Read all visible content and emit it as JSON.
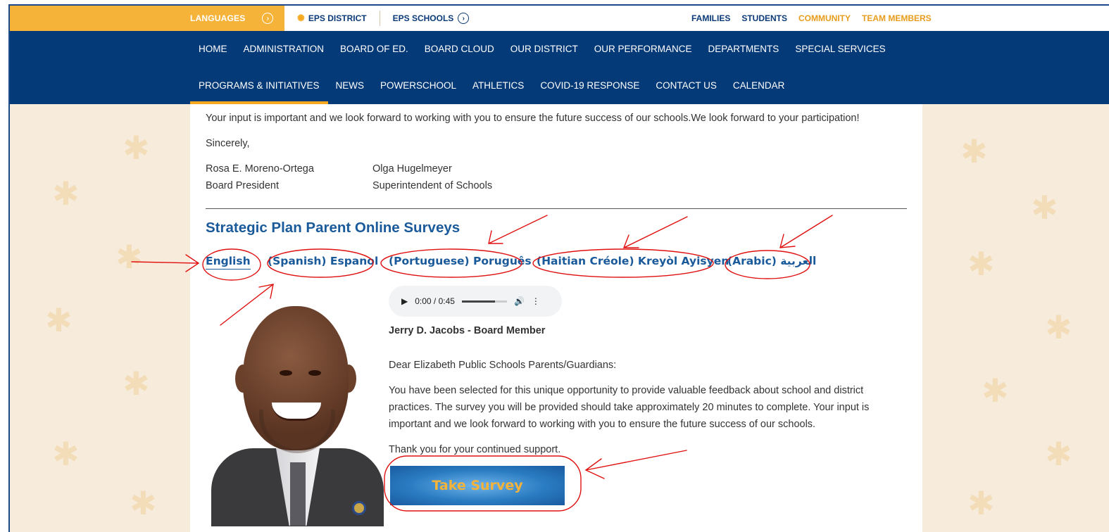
{
  "topbar": {
    "languages_label": "LANGUAGES",
    "eps_district": "EPS DISTRICT",
    "eps_schools": "EPS SCHOOLS",
    "audience": [
      {
        "label": "FAMILIES",
        "color": "blue"
      },
      {
        "label": "STUDENTS",
        "color": "blue"
      },
      {
        "label": "COMMUNITY",
        "color": "gold"
      },
      {
        "label": "TEAM MEMBERS",
        "color": "gold"
      }
    ]
  },
  "nav": {
    "row1": [
      "HOME",
      "ADMINISTRATION",
      "BOARD OF ED.",
      "BOARD CLOUD",
      "OUR DISTRICT",
      "OUR PERFORMANCE",
      "DEPARTMENTS",
      "SPECIAL SERVICES"
    ],
    "row2": [
      "PROGRAMS & INITIATIVES",
      "NEWS",
      "POWERSCHOOL",
      "ATHLETICS",
      "COVID-19 RESPONSE",
      "CONTACT US",
      "CALENDAR"
    ],
    "active": "PROGRAMS & INITIATIVES"
  },
  "letter": {
    "closing_text": "Your input is important and we look forward to working with you to ensure the future success of our schools.We look forward to your participation!",
    "sincerely": "Sincerely,",
    "signer1_name": "Rosa E. Moreno-Ortega",
    "signer1_title": "Board President",
    "signer2_name": "Olga Hugelmeyer",
    "signer2_title": "Superintendent of Schools"
  },
  "surveys": {
    "heading": "Strategic Plan Parent Online Surveys",
    "languages": [
      "English",
      "(Spanish) Espanol",
      "(Portuguese) Poruguês",
      "(Haitian Créole) Kreyòl Ayisyen",
      "(Arabic) العربية"
    ]
  },
  "audio": {
    "time": "0:00 / 0:45",
    "progress": 0.74
  },
  "message": {
    "speaker": "Jerry D. Jacobs - Board Member",
    "greeting": "Dear Elizabeth Public Schools Parents/Guardians:",
    "body": "You have been selected for this unique opportunity to provide valuable feedback about school and district practices. The survey you will be provided should take approximately 20 minutes to complete. Your input is important and we look forward to working with you to ensure the future success of our schools.",
    "thanks": "Thank you for your continued support.",
    "button_label": "Take Survey"
  },
  "colors": {
    "nav_blue": "#053a78",
    "gold": "#f6b33a",
    "link_blue": "#1a5a9a",
    "annotation_red": "#e01010"
  }
}
